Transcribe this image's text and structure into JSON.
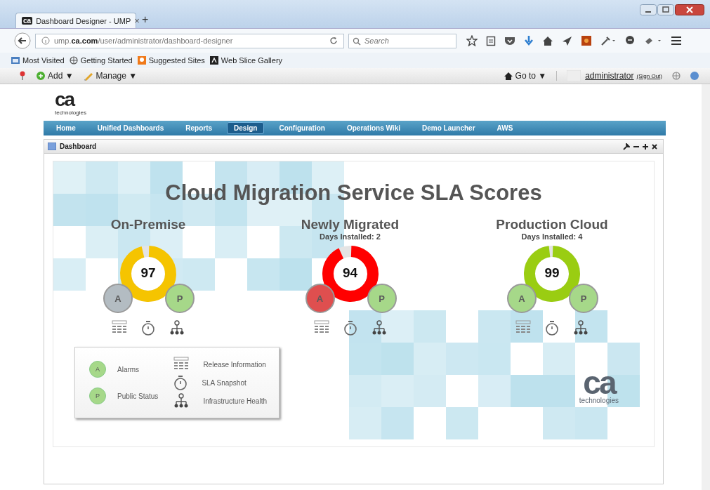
{
  "browser": {
    "tab": {
      "title": "Dashboard Designer - UMP",
      "close": "×",
      "logo": "ca"
    },
    "new_tab": "+",
    "url": "ump.**ca.com**/user/administrator/dashboard-designer",
    "search": {
      "placeholder": "Search"
    },
    "bookmarks": [
      "Most Visited",
      "Getting Started",
      "Suggested Sites",
      "Web Slice Gallery"
    ]
  },
  "app_toolbar": {
    "add": "Add ▼",
    "manage": "Manage ▼",
    "goto": "Go to ▼",
    "user": "administrator",
    "sign_out": "(Sign Out)"
  },
  "logo": {
    "mark": "ca",
    "tagline": "technologies"
  },
  "menu": [
    {
      "label": "Home",
      "selected": false
    },
    {
      "label": "Unified Dashboards",
      "selected": false
    },
    {
      "label": "Reports",
      "selected": false
    },
    {
      "label": "Design",
      "selected": true
    },
    {
      "label": "Configuration",
      "selected": false
    },
    {
      "label": "Operations Wiki",
      "selected": false
    },
    {
      "label": "Demo Launcher",
      "selected": false
    },
    {
      "label": "AWS",
      "selected": false
    }
  ],
  "panel": {
    "title": "Dashboard"
  },
  "dashboard": {
    "title": "Cloud Migration Service SLA Scores",
    "services": [
      {
        "name": "On-Premise",
        "score": "97",
        "level": 0.97,
        "color": "#f5c400",
        "alarms": {
          "letter": "A",
          "color": "#b3bcc2"
        },
        "public_status": {
          "letter": "P",
          "color": "#a6d889"
        }
      },
      {
        "name": "Newly Migrated",
        "days_installed": "Days Installed: 2",
        "score": "94",
        "level": 0.94,
        "color": "#ff0000",
        "alarms": {
          "letter": "A",
          "color": "#df4f4f"
        },
        "public_status": {
          "letter": "P",
          "color": "#a6d889"
        }
      },
      {
        "name": "Production Cloud",
        "days_installed": "Days Installed: 4",
        "score": "99",
        "level": 0.99,
        "color": "#9acd12",
        "alarms": {
          "letter": "A",
          "color": "#a6d889"
        },
        "public_status": {
          "letter": "P",
          "color": "#a6d889"
        }
      }
    ],
    "legend": {
      "badges": [
        {
          "letter": "A",
          "label": "Alarms"
        },
        {
          "letter": "P",
          "label": "Public Status"
        }
      ],
      "icons": [
        {
          "kind": "table",
          "label": "Release Information"
        },
        {
          "kind": "stopwatch",
          "label": "SLA Snapshot"
        },
        {
          "kind": "hierarchy",
          "label": "Infrastructure Health"
        }
      ]
    },
    "corner_logo": {
      "mark": "ca",
      "tagline": "technologies"
    }
  }
}
